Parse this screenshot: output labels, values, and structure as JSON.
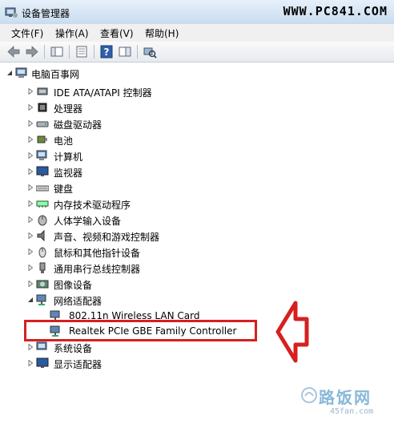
{
  "window": {
    "title": "设备管理器",
    "site_watermark": "WWW.PC841.COM"
  },
  "menu": [
    {
      "label": "文件(F)"
    },
    {
      "label": "操作(A)"
    },
    {
      "label": "查看(V)"
    },
    {
      "label": "帮助(H)"
    }
  ],
  "tree": {
    "root": "电脑百事网",
    "categories": [
      {
        "label": "IDE ATA/ATAPI 控制器",
        "icon": "ide-controller-icon"
      },
      {
        "label": "处理器",
        "icon": "processor-icon"
      },
      {
        "label": "磁盘驱动器",
        "icon": "disk-drive-icon"
      },
      {
        "label": "电池",
        "icon": "battery-icon"
      },
      {
        "label": "计算机",
        "icon": "computer-icon"
      },
      {
        "label": "监视器",
        "icon": "monitor-icon"
      },
      {
        "label": "键盘",
        "icon": "keyboard-icon"
      },
      {
        "label": "内存技术驱动程序",
        "icon": "memory-driver-icon"
      },
      {
        "label": "人体学输入设备",
        "icon": "hid-icon"
      },
      {
        "label": "声音、视频和游戏控制器",
        "icon": "sound-icon"
      },
      {
        "label": "鼠标和其他指针设备",
        "icon": "mouse-icon"
      },
      {
        "label": "通用串行总线控制器",
        "icon": "usb-icon"
      },
      {
        "label": "图像设备",
        "icon": "imaging-icon"
      },
      {
        "label": "网络适配器",
        "icon": "network-adapter-icon"
      },
      {
        "label": "系统设备",
        "icon": "system-devices-icon"
      },
      {
        "label": "显示适配器",
        "icon": "display-adapter-icon"
      }
    ],
    "network_children": [
      {
        "label": "802.11n Wireless LAN Card"
      },
      {
        "label": "Realtek PCIe GBE Family Controller"
      }
    ]
  },
  "watermark": {
    "brand": "路饭网",
    "url": "45fan.com"
  },
  "colors": {
    "highlight": "#d62020",
    "watermark": "#88b8d8"
  }
}
